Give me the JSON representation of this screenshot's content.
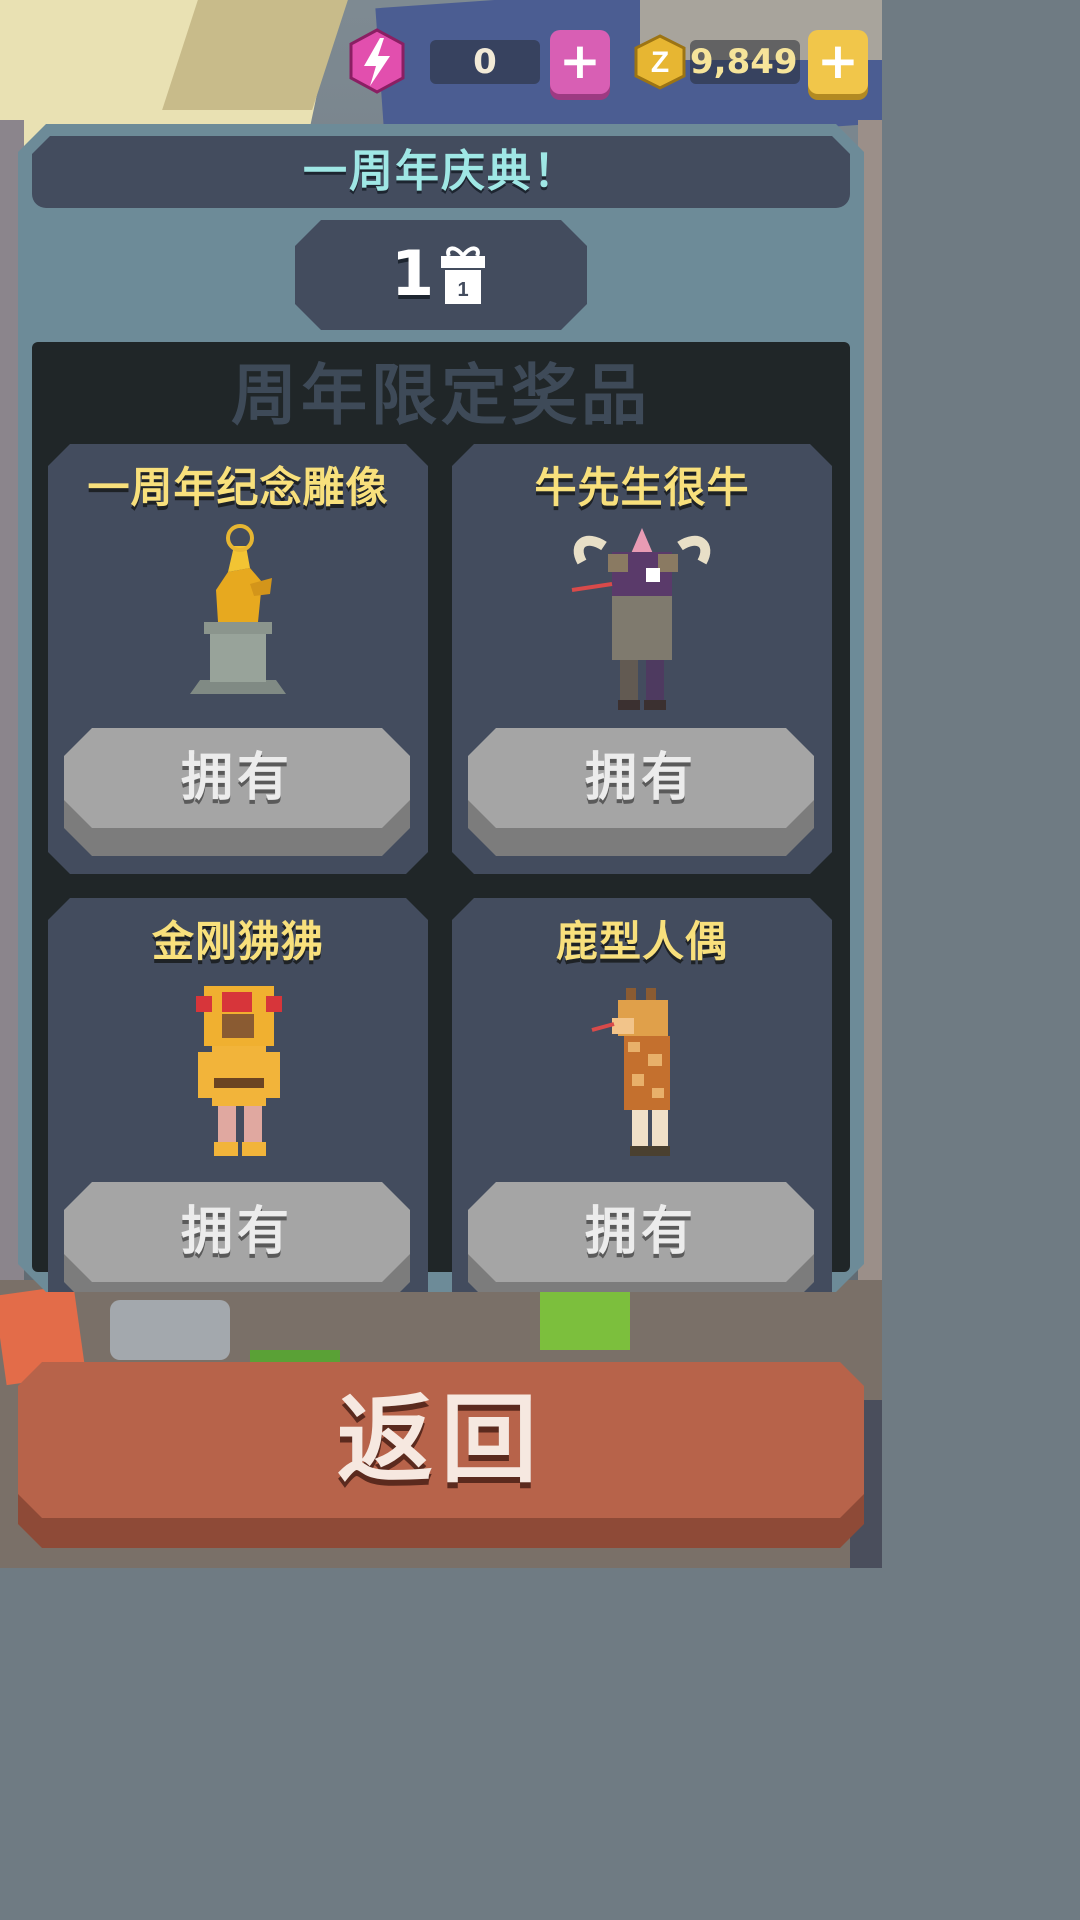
{
  "header": {
    "gems": "0",
    "coins": "9,849",
    "plus_gem_label": "+",
    "plus_coin_label": "+",
    "coin_symbol": "Z"
  },
  "panel": {
    "title": "一周年庆典！",
    "counter": "1",
    "gift_number": "1",
    "section_title": "周年限定奖品"
  },
  "rewards": [
    {
      "name": "一周年纪念雕像",
      "button": "拥有",
      "icon": "golden-statue-icon"
    },
    {
      "name": "牛先生很牛",
      "button": "拥有",
      "icon": "buffalo-costume-icon"
    },
    {
      "name": "金刚狒狒",
      "button": "拥有",
      "icon": "monkey-costume-icon"
    },
    {
      "name": "鹿型人偶",
      "button": "拥有",
      "icon": "giraffe-costume-icon"
    }
  ],
  "footer": {
    "back_label": "返回"
  },
  "colors": {
    "panel": "#6d8b98",
    "card": "#434c5e",
    "title": "#9fe7e5",
    "reward_name": "#f8e07c",
    "back_button": "#b7634a",
    "gem_plus": "#d85fb4",
    "coin_plus": "#f1c64a"
  }
}
